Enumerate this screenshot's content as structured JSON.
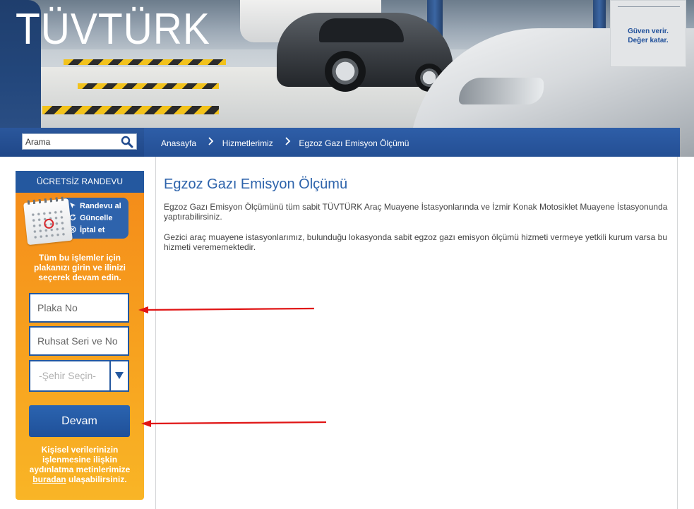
{
  "header": {
    "logo_text": "TÜVTÜRK",
    "slogan_line1": "Güven verir.",
    "slogan_line2": "Değer katar."
  },
  "search": {
    "placeholder": "Arama",
    "value": "Arama",
    "icon": "search-icon"
  },
  "breadcrumb": {
    "items": [
      "Anasayfa",
      "Hizmetlerimiz",
      "Egzoz Gazı Emisyon Ölçümü"
    ]
  },
  "sidebar": {
    "title": "ÜCRETSİZ RANDEVU",
    "menu": [
      {
        "label": "Randevu al",
        "icon": "cursor-arrow-icon"
      },
      {
        "label": "Güncelle",
        "icon": "refresh-icon"
      },
      {
        "label": "İptal et",
        "icon": "cancel-icon"
      }
    ],
    "info": "Tüm bu işlemler için plakanızı girin ve ilinizi seçerek devam edin.",
    "plate_placeholder": "Plaka No",
    "license_placeholder": "Ruhsat Seri ve No",
    "city_select": "-Şehir Seçin-",
    "submit_label": "Devam",
    "footer_text_before": "Kişisel verilerinizin işlenmesine ilişkin aydınlatma metinlerimize",
    "footer_link": "buradan",
    "footer_text_after": "ulaşabilirsiniz."
  },
  "main": {
    "title": "Egzoz Gazı Emisyon Ölçümü",
    "paragraphs": [
      "Egzoz Gazı Emisyon Ölçümünü tüm sabit TÜVTÜRK Araç Muayene İstasyonlarında ve İzmir Konak Motosiklet Muayene İstasyonunda yaptırabilirsiniz.",
      "Gezici araç muayene istasyonlarımız, bulunduğu lokasyonda sabit egzoz gazı emisyon ölçümü hizmeti vermeye yetkili kurum varsa bu hizmeti verememektedir."
    ]
  },
  "colors": {
    "brand_blue": "#24589f",
    "title_blue": "#2d63ab",
    "orange": "#f7a21f",
    "annotation_red": "#e01515"
  }
}
